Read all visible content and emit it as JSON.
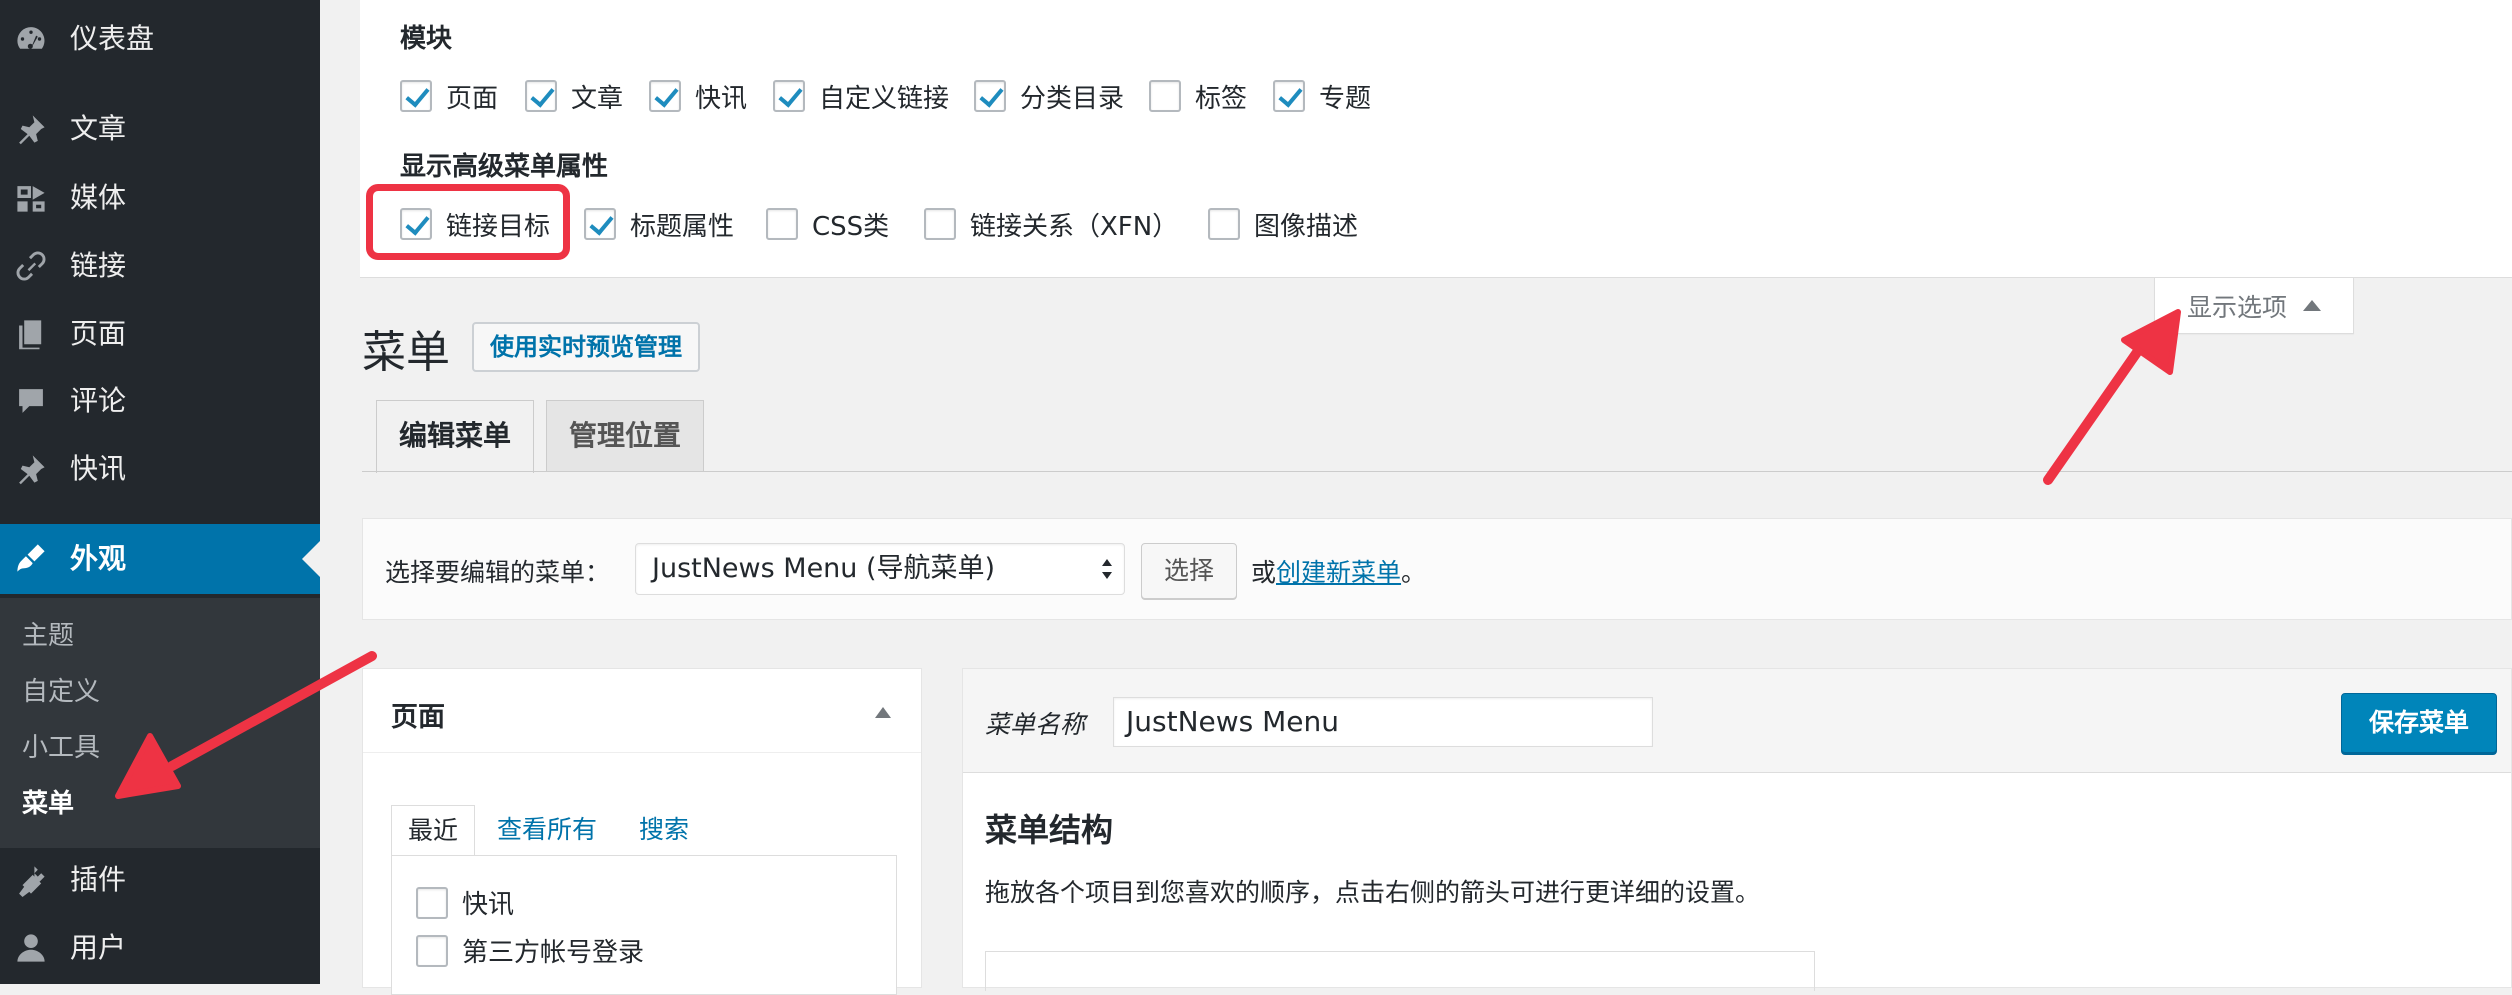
{
  "sidebar": {
    "items": [
      {
        "label": "仪表盘",
        "icon": "dashboard-icon"
      },
      {
        "label": "文章",
        "icon": "pin-icon"
      },
      {
        "label": "媒体",
        "icon": "media-icon"
      },
      {
        "label": "链接",
        "icon": "link-icon"
      },
      {
        "label": "页面",
        "icon": "page-icon"
      },
      {
        "label": "评论",
        "icon": "comment-icon"
      },
      {
        "label": "快讯",
        "icon": "pin-icon"
      },
      {
        "label": "外观",
        "icon": "appearance-brush-icon"
      },
      {
        "label": "插件",
        "icon": "plugin-icon"
      },
      {
        "label": "用户",
        "icon": "user-icon"
      }
    ],
    "submenu": [
      "主题",
      "自定义",
      "小工具",
      "菜单"
    ]
  },
  "screen_options": {
    "modules_title": "模块",
    "modules": [
      {
        "label": "页面",
        "checked": true
      },
      {
        "label": "文章",
        "checked": true
      },
      {
        "label": "快讯",
        "checked": true
      },
      {
        "label": "自定义链接",
        "checked": true
      },
      {
        "label": "分类目录",
        "checked": true
      },
      {
        "label": "标签",
        "checked": false
      },
      {
        "label": "专题",
        "checked": true
      }
    ],
    "advanced_title": "显示高级菜单属性",
    "advanced": [
      {
        "label": "链接目标",
        "checked": true
      },
      {
        "label": "标题属性",
        "checked": true
      },
      {
        "label": "CSS类",
        "checked": false
      },
      {
        "label": "链接关系（XFN）",
        "checked": false
      },
      {
        "label": "图像描述",
        "checked": false
      }
    ],
    "toggle_label": "显示选项"
  },
  "page": {
    "title": "菜单",
    "live_preview_button": "使用实时预览管理",
    "tabs": [
      "编辑菜单",
      "管理位置"
    ]
  },
  "select_bar": {
    "label": "选择要编辑的菜单：",
    "selected_menu": "JustNews Menu (导航菜单)",
    "choose_button": "选择",
    "or_text": "或",
    "create_link": "创建新菜单",
    "period": "。"
  },
  "pages_box": {
    "title": "页面",
    "tabs": [
      "最近",
      "查看所有",
      "搜索"
    ],
    "items": [
      "快讯",
      "第三方帐号登录"
    ]
  },
  "menu_editor": {
    "name_label": "菜单名称",
    "name_value": "JustNews Menu",
    "save_button": "保存菜单",
    "structure_title": "菜单结构",
    "structure_desc": "拖放各个项目到您喜欢的顺序，点击右侧的箭头可进行更详细的设置。"
  },
  "colors": {
    "sidebar_bg": "#23282d",
    "active_blue": "#0073aa",
    "annotation_red": "#ee3344"
  }
}
